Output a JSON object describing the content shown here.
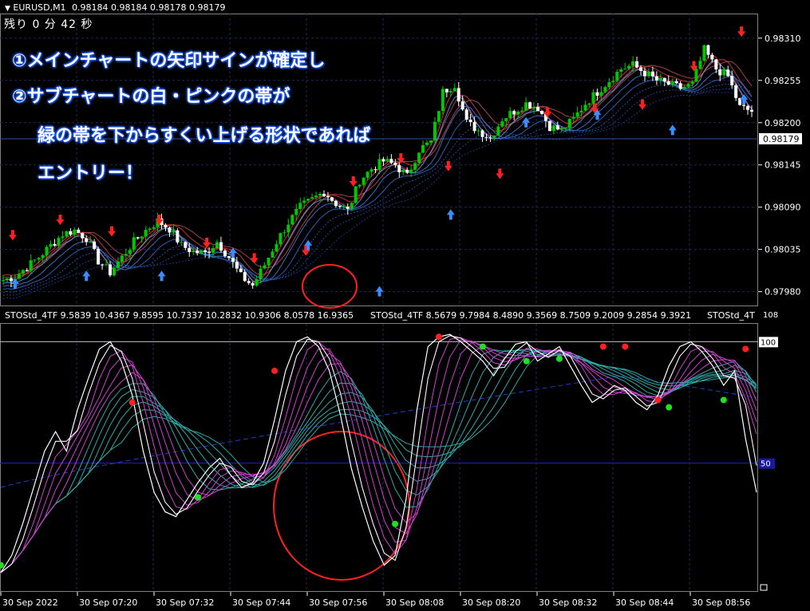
{
  "header": {
    "symbol": "EURUSD,M1",
    "ohlc": "0.98184 0.98184 0.98178 0.98179",
    "timer": "残り 0 分 42 秒",
    "dropdown_icon": "triangle-down-icon"
  },
  "annotation": {
    "line1": "①メインチャートの矢印サインが確定し",
    "line2": "②サブチャートの白・ピンクの帯が",
    "line3": "緑の帯を下からすくい上げる形状であれば",
    "line4": "エントリー！"
  },
  "sub_header": {
    "text1": "STOStd_4TF 9.5839 10.4367 9.8595 10.7337 10.2832 10.9306 8.0578 16.9365",
    "text2": "STOStd_4TF 8.5679 9.7984 8.4890 9.3569 8.7509 9.2009 9.2854 9.3921",
    "text3": "STOStd_4T"
  },
  "colors": {
    "background": "#000000",
    "bull_candle": "#00c800",
    "bear_candle": "#ffffff",
    "sell_arrow": "#ff2020",
    "buy_arrow": "#3a8dff",
    "highlight_circle": "#ff2020",
    "grid": "#1c2a5a",
    "ref_line": "#2020c0",
    "sto_main": "#ffffff",
    "sto_pink": "#d040d0",
    "sto_teal": "#30a8a8",
    "dot_green": "#20e020",
    "dot_red": "#ff2020"
  },
  "chart_data": [
    {
      "type": "candlestick",
      "title": "EURUSD,M1",
      "price_axis_labels": [
        "0.98310",
        "0.98255",
        "0.98200",
        "0.98145",
        "0.98090",
        "0.98035",
        "0.97980"
      ],
      "current_price": "0.98179",
      "ylim": [
        0.97962,
        0.98342
      ],
      "x_tick_labels": [
        "30 Sep 2022",
        "30 Sep 07:20",
        "30 Sep 07:32",
        "30 Sep 07:44",
        "30 Sep 07:56",
        "30 Sep 08:08",
        "30 Sep 08:20",
        "30 Sep 08:32",
        "30 Sep 08:44",
        "30 Sep 08:56"
      ],
      "close_path": [
        0.97995,
        0.98,
        0.98012,
        0.98025,
        0.9804,
        0.98055,
        0.9806,
        0.9805,
        0.9802,
        0.98005,
        0.98025,
        0.98045,
        0.9806,
        0.98072,
        0.98062,
        0.9804,
        0.98032,
        0.9803,
        0.98045,
        0.98025,
        0.98,
        0.97988,
        0.98015,
        0.98045,
        0.9807,
        0.9809,
        0.981,
        0.9811,
        0.98095,
        0.98085,
        0.98125,
        0.9814,
        0.9815,
        0.98145,
        0.9813,
        0.98165,
        0.98175,
        0.9824,
        0.9825,
        0.982,
        0.9819,
        0.9818,
        0.98205,
        0.98215,
        0.98225,
        0.9822,
        0.98195,
        0.9819,
        0.98205,
        0.98225,
        0.9824,
        0.98255,
        0.9827,
        0.98275,
        0.98265,
        0.98255,
        0.9825,
        0.98245,
        0.9825,
        0.98295,
        0.9827,
        0.9826,
        0.9822,
        0.98215
      ],
      "sell_arrow_price_levels": [
        0.98055,
        0.98075,
        0.9806,
        0.98075,
        0.98045,
        0.98025,
        0.98035,
        0.98125,
        0.98155,
        0.98145,
        0.98135,
        0.98215,
        0.9822,
        0.98225,
        0.98275,
        0.9832
      ],
      "buy_arrow_price_levels": [
        0.9799,
        0.98,
        0.98,
        0.9803,
        0.9804,
        0.9798,
        0.9808,
        0.982,
        0.9821,
        0.9819,
        0.9823
      ]
    },
    {
      "type": "line",
      "title": "STOStd_4TF",
      "ylim": [
        0,
        108
      ],
      "axis_labels": [
        "108",
        "100",
        "50"
      ],
      "reference_level": 50,
      "main_line": [
        5,
        12,
        25,
        40,
        55,
        63,
        55,
        72,
        85,
        97,
        100,
        92,
        78,
        55,
        38,
        30,
        28,
        35,
        42,
        48,
        52,
        45,
        40,
        42,
        50,
        68,
        88,
        100,
        102,
        98,
        88,
        70,
        48,
        32,
        18,
        8,
        12,
        35,
        72,
        98,
        102,
        103,
        100,
        96,
        92,
        86,
        93,
        99,
        100,
        92,
        95,
        98,
        90,
        82,
        75,
        78,
        82,
        80,
        75,
        72,
        78,
        90,
        98,
        100,
        96,
        90,
        82,
        88,
        60,
        38
      ],
      "signal_band_lag": 5,
      "baseline_start": 40,
      "baseline_end": 95,
      "green_dots": [
        [
          0,
          8
        ],
        [
          18,
          36
        ],
        [
          36,
          25
        ],
        [
          44,
          98
        ],
        [
          48,
          92
        ],
        [
          51,
          93
        ],
        [
          61,
          73
        ],
        [
          66,
          76
        ]
      ],
      "red_dots": [
        [
          12,
          75
        ],
        [
          25,
          88
        ],
        [
          40,
          102
        ],
        [
          55,
          98
        ],
        [
          57,
          98
        ],
        [
          60,
          76
        ],
        [
          68,
          97
        ]
      ]
    }
  ]
}
